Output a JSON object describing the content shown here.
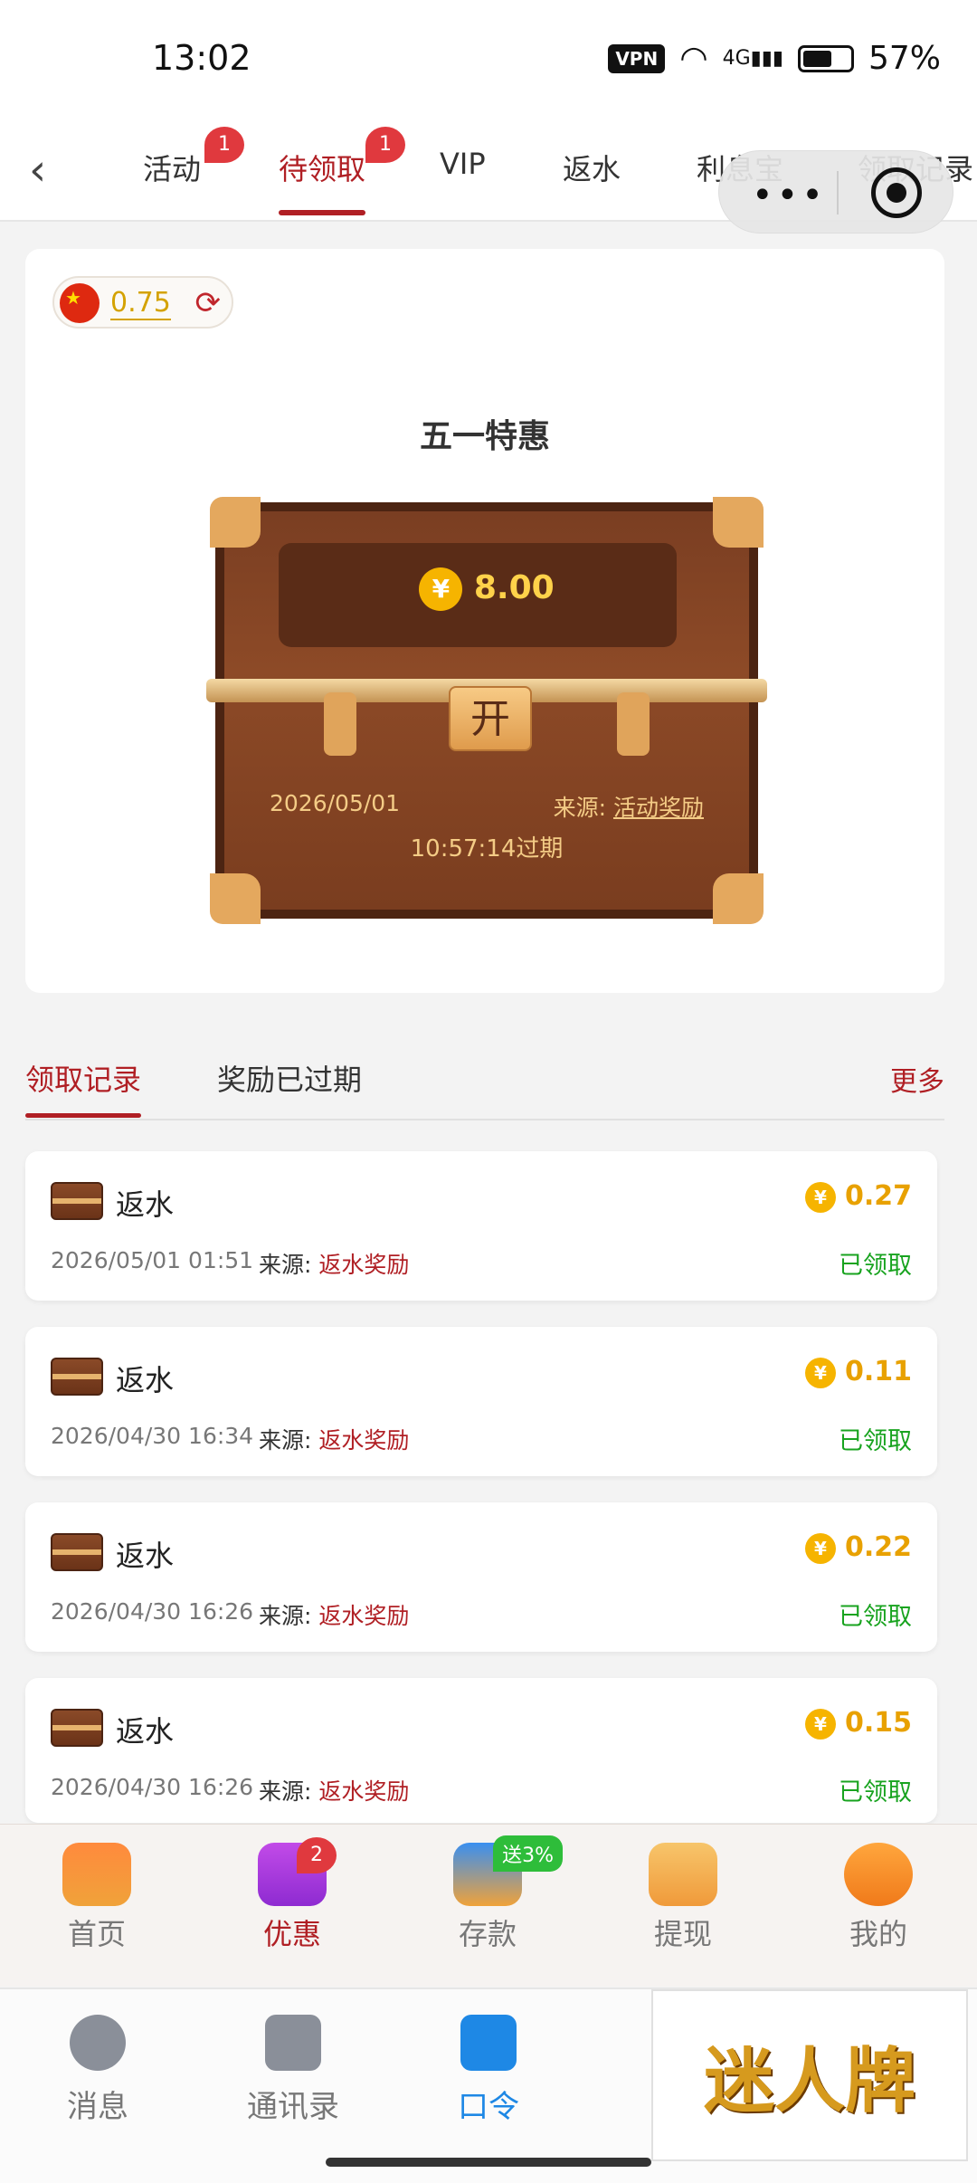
{
  "status_bar": {
    "time": "13:02",
    "vpn": "VPN",
    "network": "4G",
    "battery": "57%"
  },
  "top_tabs": [
    {
      "label": "活动",
      "badge": "1"
    },
    {
      "label": "待领取",
      "badge": "1",
      "active": true
    },
    {
      "label": "VIP"
    },
    {
      "label": "返水"
    },
    {
      "label": "利息宝"
    },
    {
      "label": "领取记录"
    }
  ],
  "balance": {
    "amount": "0.75"
  },
  "promo": {
    "title": "五一特惠",
    "reward_symbol": "¥",
    "reward": "8.00",
    "lock_label": "开",
    "date": "2026/05/01",
    "source_label": "来源:",
    "source_value": "活动奖励",
    "expire": "10:57:14过期"
  },
  "record_tabs": {
    "tab1": "领取记录",
    "tab2": "奖励已过期",
    "more": "更多"
  },
  "records": [
    {
      "name": "返水",
      "time": "2026/05/01 01:51",
      "source_label": "来源:",
      "source": "返水奖励",
      "amount": "0.27",
      "status": "已领取"
    },
    {
      "name": "返水",
      "time": "2026/04/30 16:34",
      "source_label": "来源:",
      "source": "返水奖励",
      "amount": "0.11",
      "status": "已领取"
    },
    {
      "name": "返水",
      "time": "2026/04/30 16:26",
      "source_label": "来源:",
      "source": "返水奖励",
      "amount": "0.22",
      "status": "已领取"
    },
    {
      "name": "返水",
      "time": "2026/04/30 16:26",
      "source_label": "来源:",
      "source": "返水奖励",
      "amount": "0.15",
      "status": "已领取"
    }
  ],
  "app_nav": [
    {
      "label": "首页"
    },
    {
      "label": "优惠",
      "badge": "2",
      "active": true
    },
    {
      "label": "存款",
      "badge": "送3%"
    },
    {
      "label": "提现"
    },
    {
      "label": "我的"
    }
  ],
  "host_nav": [
    {
      "label": "消息"
    },
    {
      "label": "通讯录"
    },
    {
      "label": "口令",
      "active": true
    }
  ],
  "ad_text": "迷人牌",
  "colors": {
    "accent": "#b01f24",
    "gold": "#e8a100",
    "success": "#18a31f",
    "host_active": "#1e88e5"
  }
}
